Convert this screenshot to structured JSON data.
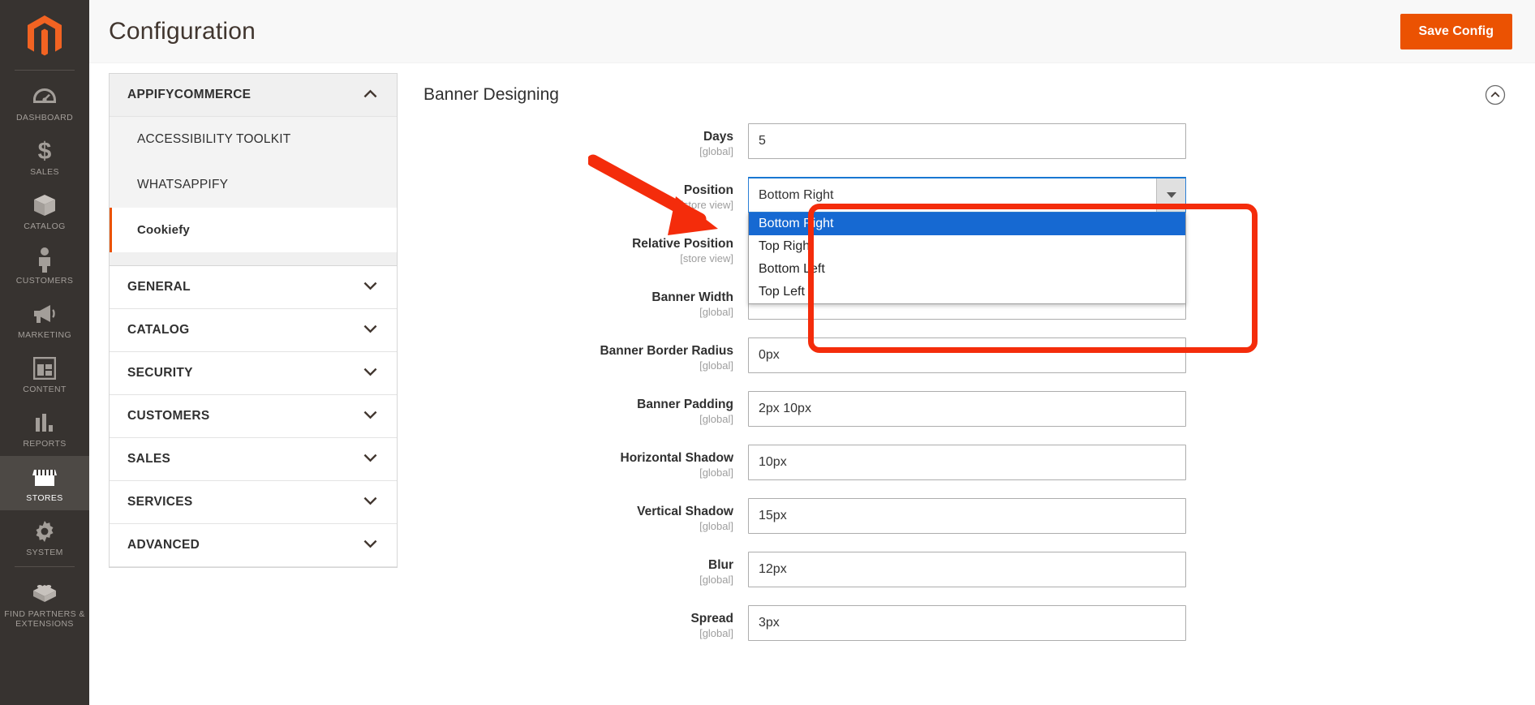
{
  "rail": {
    "logo_name": "magento-logo",
    "items": [
      {
        "id": "dashboard",
        "label": "DASHBOARD",
        "icon": "gauge-icon",
        "active": false
      },
      {
        "id": "sales",
        "label": "SALES",
        "icon": "dollar-icon",
        "active": false
      },
      {
        "id": "catalog",
        "label": "CATALOG",
        "icon": "box-icon",
        "active": false
      },
      {
        "id": "customers",
        "label": "CUSTOMERS",
        "icon": "person-icon",
        "active": false
      },
      {
        "id": "marketing",
        "label": "MARKETING",
        "icon": "megaphone-icon",
        "active": false
      },
      {
        "id": "content",
        "label": "CONTENT",
        "icon": "layout-icon",
        "active": false
      },
      {
        "id": "reports",
        "label": "REPORTS",
        "icon": "bar-chart-icon",
        "active": false
      },
      {
        "id": "stores",
        "label": "STORES",
        "icon": "storefront-icon",
        "active": true
      },
      {
        "id": "system",
        "label": "SYSTEM",
        "icon": "gear-icon",
        "active": false
      },
      {
        "id": "find-partners",
        "label": "FIND PARTNERS & EXTENSIONS",
        "icon": "brick-icon",
        "active": false
      }
    ]
  },
  "header": {
    "title": "Configuration",
    "save_label": "Save Config"
  },
  "confignav": {
    "appify": {
      "header": "APPIFYCOMMERCE",
      "chevron": "chevron-up-icon",
      "items": [
        {
          "label": "ACCESSIBILITY TOOLKIT",
          "current": false
        },
        {
          "label": "WHATSAPPIFY",
          "current": false
        },
        {
          "label": "Cookiefy",
          "current": true
        }
      ]
    },
    "sections": [
      {
        "label": "GENERAL",
        "chevron": "chevron-down-icon"
      },
      {
        "label": "CATALOG",
        "chevron": "chevron-down-icon"
      },
      {
        "label": "SECURITY",
        "chevron": "chevron-down-icon"
      },
      {
        "label": "CUSTOMERS",
        "chevron": "chevron-down-icon"
      },
      {
        "label": "SALES",
        "chevron": "chevron-down-icon"
      },
      {
        "label": "SERVICES",
        "chevron": "chevron-down-icon"
      },
      {
        "label": "ADVANCED",
        "chevron": "chevron-down-icon"
      }
    ]
  },
  "main": {
    "section_title": "Banner Designing",
    "collapse_icon": "chevron-up-circle-icon",
    "fields": {
      "days": {
        "label": "Days",
        "scope": "[global]",
        "value": "5"
      },
      "position": {
        "label": "Position",
        "scope": "[store view]",
        "selected": "Bottom Right",
        "options": [
          "Bottom Right",
          "Top Right",
          "Bottom Left",
          "Top Left"
        ],
        "open": true,
        "dropdown_arrow": "triangle-down-icon"
      },
      "relative_position": {
        "label": "Relative Position",
        "scope": "[store view]",
        "value": ""
      },
      "banner_width": {
        "label": "Banner Width",
        "scope": "[global]",
        "value": ""
      },
      "banner_border_radius": {
        "label": "Banner Border Radius",
        "scope": "[global]",
        "value": "0px"
      },
      "banner_padding": {
        "label": "Banner Padding",
        "scope": "[global]",
        "value": "2px 10px"
      },
      "horizontal_shadow": {
        "label": "Horizontal Shadow",
        "scope": "[global]",
        "value": "10px"
      },
      "vertical_shadow": {
        "label": "Vertical Shadow",
        "scope": "[global]",
        "value": "15px"
      },
      "blur": {
        "label": "Blur",
        "scope": "[global]",
        "value": "12px"
      },
      "spread": {
        "label": "Spread",
        "scope": "[global]",
        "value": "3px"
      }
    }
  },
  "annotations": {
    "arrow": {
      "name": "red-arrow-pointer",
      "color": "#f42c0b"
    },
    "highlight": {
      "name": "red-highlight-box",
      "color": "#f42c0b"
    }
  },
  "colors": {
    "brand_orange": "#eb5202",
    "rail_bg": "#373330",
    "select_highlight": "#1669d2",
    "annotation_red": "#f42c0b"
  }
}
